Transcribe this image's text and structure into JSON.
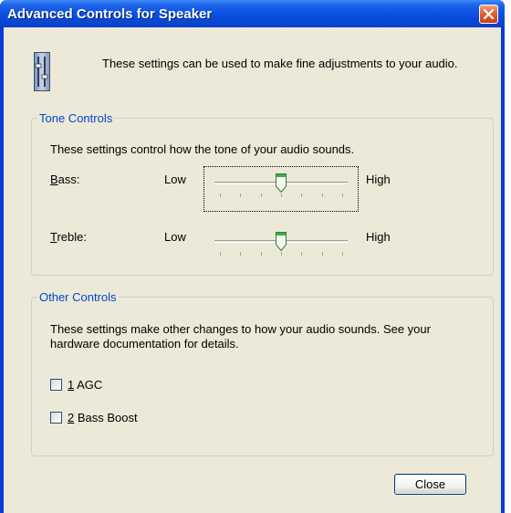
{
  "window": {
    "title": "Advanced Controls for Speaker"
  },
  "header": {
    "text": "These settings can be used to make fine adjustments to your audio."
  },
  "tone_controls": {
    "title": "Tone Controls",
    "description": "These settings control how the tone of your audio sounds.",
    "bass": {
      "label_prefix": "B",
      "label_rest": "ass:",
      "low": "Low",
      "high": "High",
      "level": 0.5
    },
    "treble": {
      "label_prefix": "T",
      "label_rest": "reble:",
      "low": "Low",
      "high": "High",
      "level": 0.5
    }
  },
  "other_controls": {
    "title": "Other Controls",
    "description": "These settings make other changes to how your audio sounds.  See your hardware documentation for details.",
    "options": [
      {
        "number": "1",
        "label": "AGC",
        "checked": false
      },
      {
        "number": "2",
        "label": "Bass Boost",
        "checked": false
      }
    ]
  },
  "footer": {
    "close_label": "Close"
  }
}
